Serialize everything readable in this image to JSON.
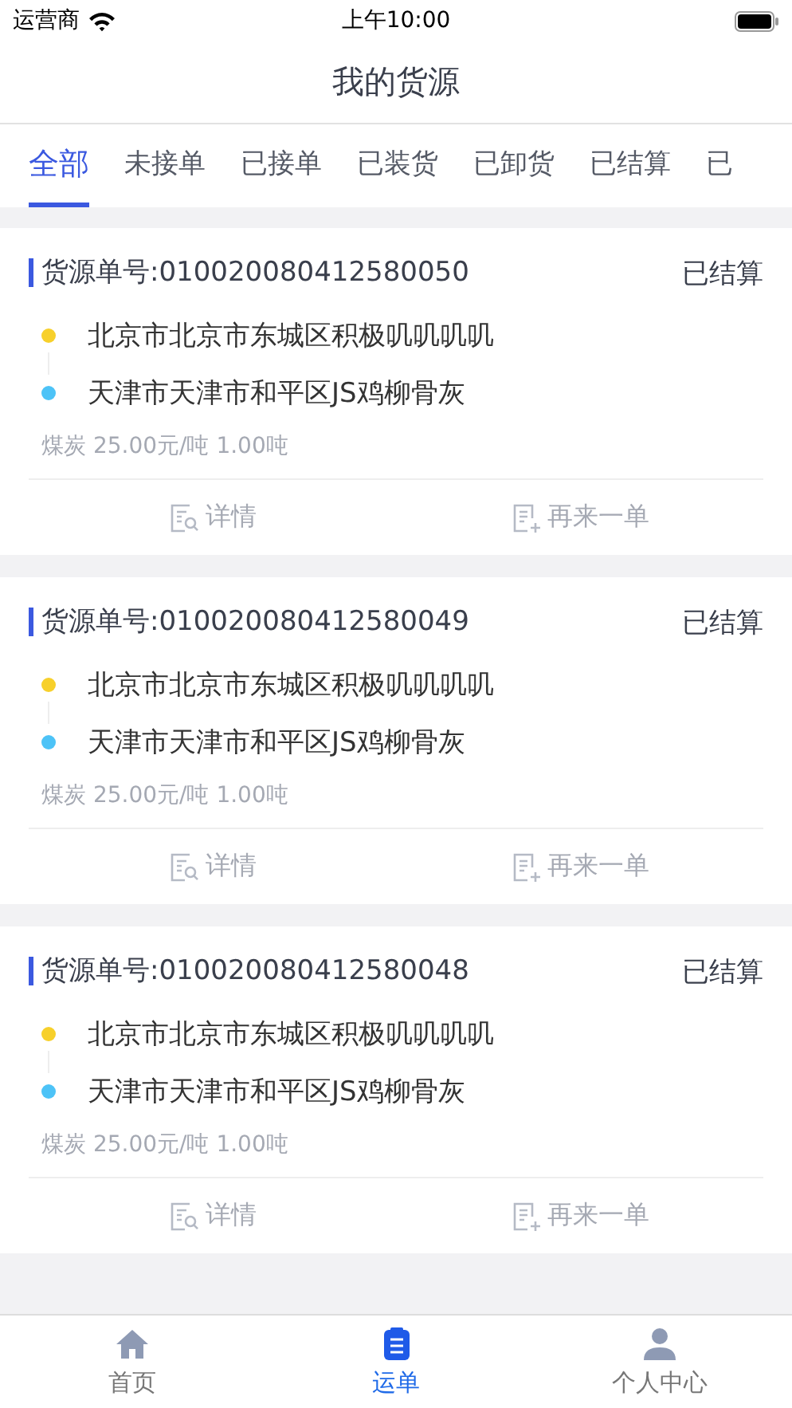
{
  "status_bar": {
    "carrier": "运营商",
    "time": "上午10:00"
  },
  "title": "我的货源",
  "tabs": [
    {
      "label": "全部",
      "selected": true
    },
    {
      "label": "未接单",
      "selected": false
    },
    {
      "label": "已接单",
      "selected": false
    },
    {
      "label": "已装货",
      "selected": false
    },
    {
      "label": "已卸货",
      "selected": false
    },
    {
      "label": "已结算",
      "selected": false
    },
    {
      "label": "已",
      "selected": false
    }
  ],
  "orders": [
    {
      "number": "货源单号:010020080412580050",
      "status": "已结算",
      "from": "北京市北京市东城区积极叽叽叽叽",
      "to": "天津市天津市和平区JS鸡柳骨灰",
      "cargo": "煤炭 25.00元/吨 1.00吨",
      "actions": [
        "详情",
        "再来一单"
      ]
    },
    {
      "number": "货源单号:010020080412580049",
      "status": "已结算",
      "from": "北京市北京市东城区积极叽叽叽叽",
      "to": "天津市天津市和平区JS鸡柳骨灰",
      "cargo": "煤炭 25.00元/吨 1.00吨",
      "actions": [
        "详情",
        "再来一单"
      ]
    },
    {
      "number": "货源单号:010020080412580048",
      "status": "已结算",
      "from": "北京市北京市东城区积极叽叽叽叽",
      "to": "天津市天津市和平区JS鸡柳骨灰",
      "cargo": "煤炭 25.00元/吨 1.00吨",
      "actions": [
        "详情",
        "再来一单"
      ]
    }
  ],
  "bottom_nav": [
    {
      "label": "首页",
      "kind": "home",
      "selected": false
    },
    {
      "label": "运单",
      "kind": "orders",
      "selected": true
    },
    {
      "label": "个人中心",
      "kind": "person",
      "selected": false
    }
  ]
}
